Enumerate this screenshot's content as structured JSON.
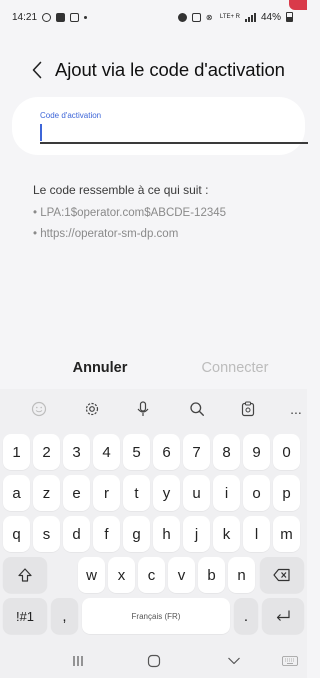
{
  "status_bar": {
    "time": "14:21",
    "battery": "44%",
    "network": "LTE+ R"
  },
  "header": {
    "title": "Ajout via le code d'activation"
  },
  "input": {
    "label": "Code d'activation",
    "value": ""
  },
  "hint": {
    "title": "Le code ressemble à ce qui suit :",
    "examples": [
      "• LPA:1$operator.com$ABCDE-12345",
      "• https://operator-sm-dp.com"
    ]
  },
  "actions": {
    "cancel": "Annuler",
    "connect": "Connecter"
  },
  "keyboard": {
    "toolbar": [
      "emoji-icon",
      "settings-icon",
      "microphone-icon",
      "search-icon",
      "clipboard-icon",
      "more-icon"
    ],
    "more": "...",
    "row1": [
      "1",
      "2",
      "3",
      "4",
      "5",
      "6",
      "7",
      "8",
      "9",
      "0"
    ],
    "row2": [
      "a",
      "z",
      "e",
      "r",
      "t",
      "y",
      "u",
      "i",
      "o",
      "p"
    ],
    "row3": [
      "q",
      "s",
      "d",
      "f",
      "g",
      "h",
      "j",
      "k",
      "l",
      "m"
    ],
    "row4": [
      "w",
      "x",
      "c",
      "v",
      "b",
      "n"
    ],
    "symbols": "!#1",
    "comma": ",",
    "space": "Français (FR)",
    "period": "."
  }
}
